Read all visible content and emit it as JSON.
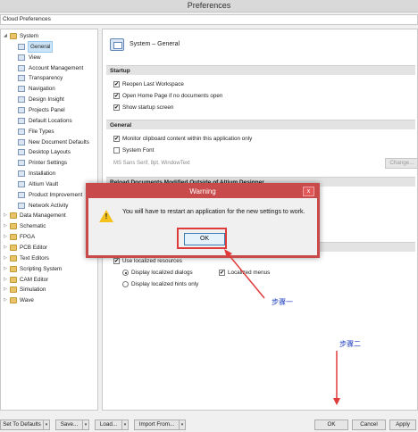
{
  "window": {
    "title": "Preferences"
  },
  "search": {
    "value": "Cloud Preferences"
  },
  "tree": {
    "items": [
      {
        "label": "System",
        "level": 0,
        "expanded": true,
        "kind": "folder"
      },
      {
        "label": "General",
        "level": 1,
        "kind": "page",
        "selected": true
      },
      {
        "label": "View",
        "level": 1,
        "kind": "page"
      },
      {
        "label": "Account Management",
        "level": 1,
        "kind": "page"
      },
      {
        "label": "Transparency",
        "level": 1,
        "kind": "page"
      },
      {
        "label": "Navigation",
        "level": 1,
        "kind": "page"
      },
      {
        "label": "Design Insight",
        "level": 1,
        "kind": "page"
      },
      {
        "label": "Projects Panel",
        "level": 1,
        "kind": "page"
      },
      {
        "label": "Default Locations",
        "level": 1,
        "kind": "page"
      },
      {
        "label": "File Types",
        "level": 1,
        "kind": "page"
      },
      {
        "label": "New Document Defaults",
        "level": 1,
        "kind": "page"
      },
      {
        "label": "Desktop Layouts",
        "level": 1,
        "kind": "page"
      },
      {
        "label": "Printer Settings",
        "level": 1,
        "kind": "page"
      },
      {
        "label": "Installation",
        "level": 1,
        "kind": "page"
      },
      {
        "label": "Altium Vault",
        "level": 1,
        "kind": "page"
      },
      {
        "label": "Product Improvement",
        "level": 1,
        "kind": "page"
      },
      {
        "label": "Network Activity",
        "level": 1,
        "kind": "page"
      },
      {
        "label": "Data Management",
        "level": 0,
        "expanded": false,
        "kind": "folder"
      },
      {
        "label": "Schematic",
        "level": 0,
        "expanded": false,
        "kind": "folder"
      },
      {
        "label": "FPGA",
        "level": 0,
        "expanded": false,
        "kind": "folder"
      },
      {
        "label": "PCB Editor",
        "level": 0,
        "expanded": false,
        "kind": "folder"
      },
      {
        "label": "Text Editors",
        "level": 0,
        "expanded": false,
        "kind": "folder"
      },
      {
        "label": "Scripting System",
        "level": 0,
        "expanded": false,
        "kind": "folder"
      },
      {
        "label": "CAM Editor",
        "level": 0,
        "expanded": false,
        "kind": "folder"
      },
      {
        "label": "Simulation",
        "level": 0,
        "expanded": false,
        "kind": "folder"
      },
      {
        "label": "Wave",
        "level": 0,
        "expanded": false,
        "kind": "folder"
      }
    ]
  },
  "content": {
    "title": "System – General",
    "startup": {
      "header": "Startup",
      "reopen": "Reopen Last Workspace",
      "open_home": "Open Home Page if no documents open",
      "show_startup": "Show startup screen"
    },
    "general": {
      "header": "General",
      "monitor_clipboard": "Monitor clipboard content within this application only",
      "system_font": "System Font",
      "font_info": "MS Sans Serif, 8pt, WindowText",
      "change_button": "Change..."
    },
    "reload": {
      "header": "Reload Documents Modified Outside of Altium Designer"
    },
    "localization": {
      "use_localized": "Use localized resources",
      "display_dialogs": "Display localized dialogs",
      "localized_menus": "Localized menus",
      "display_hints": "Display localized hints only"
    }
  },
  "footer": {
    "set_defaults": "Set To Defaults",
    "save": "Save...",
    "load": "Load...",
    "import_from": "Import From...",
    "ok": "OK",
    "cancel": "Cancel",
    "apply": "Apply"
  },
  "dialog": {
    "title": "Warning",
    "close": "x",
    "message": "You will have to restart an application for the new settings to work.",
    "ok": "OK",
    "icon": "warning-icon"
  },
  "annotations": {
    "step1": "步骤一",
    "step2": "步骤二",
    "color": "#e03b3b"
  }
}
